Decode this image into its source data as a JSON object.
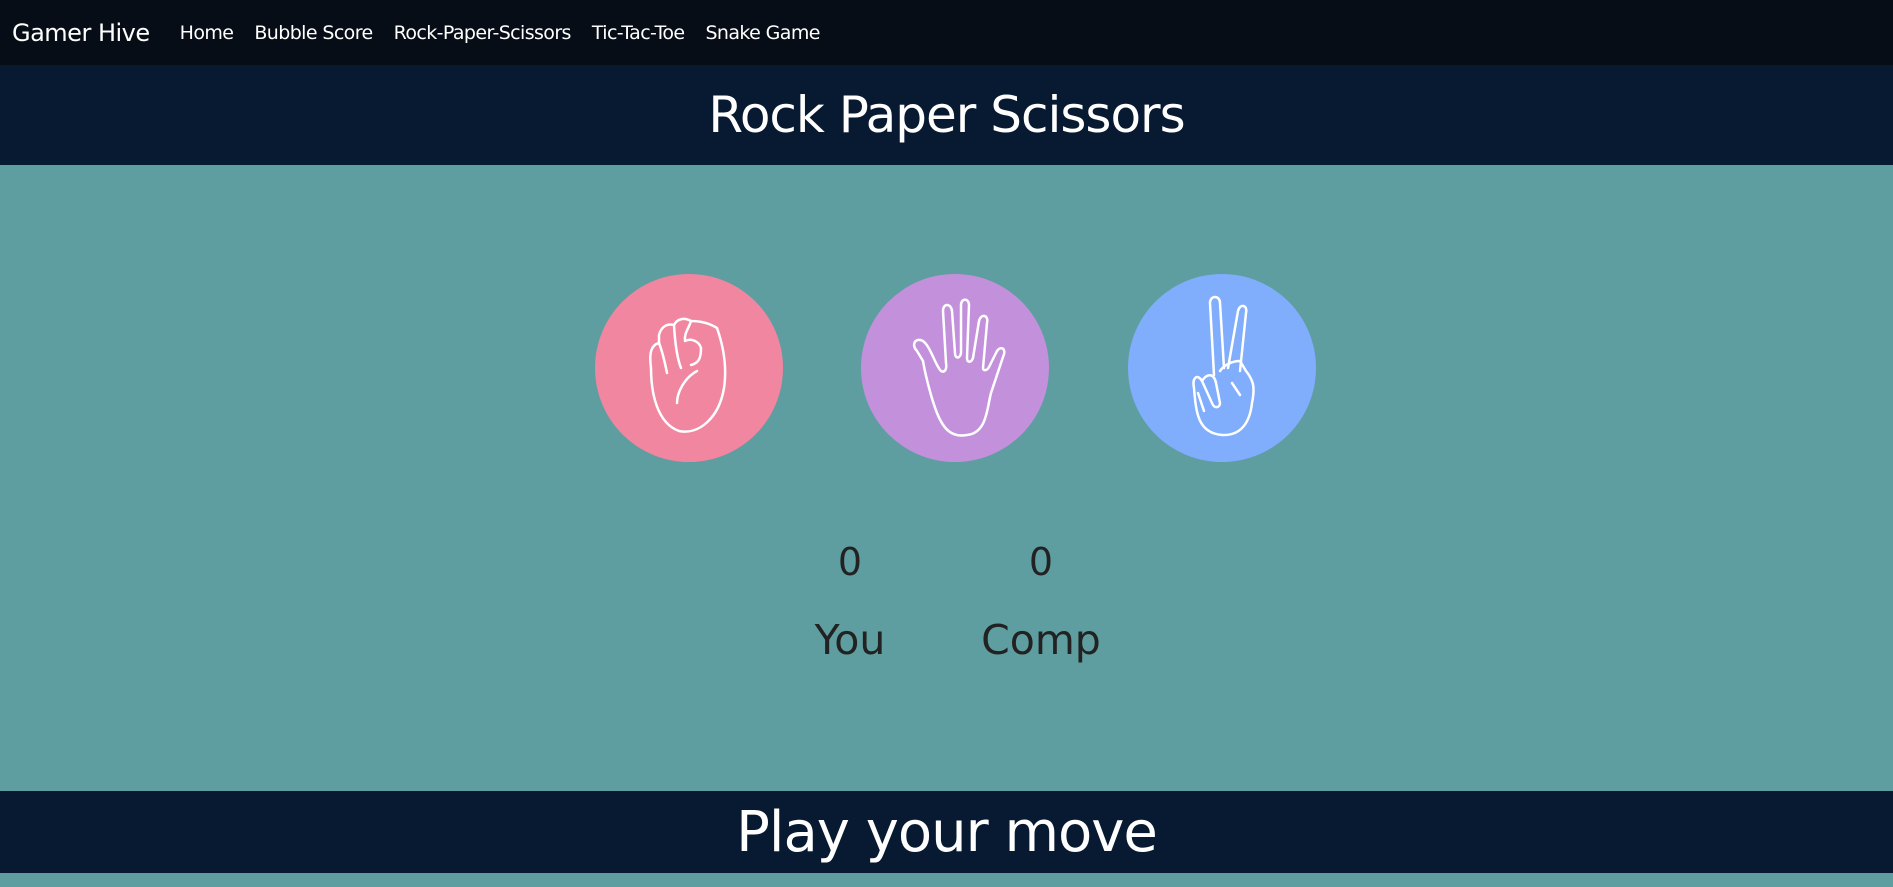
{
  "nav": {
    "brand": "Gamer Hive",
    "links": [
      "Home",
      "Bubble Score",
      "Rock-Paper-Scissors",
      "Tic-Tac-Toe",
      "Snake Game"
    ]
  },
  "header": {
    "title": "Rock Paper Scissors"
  },
  "choices": [
    {
      "name": "rock",
      "icon": "fist-icon",
      "color": "#f086a0"
    },
    {
      "name": "paper",
      "icon": "open-hand-icon",
      "color": "#c390dc"
    },
    {
      "name": "scissors",
      "icon": "peace-hand-icon",
      "color": "#80adfc"
    }
  ],
  "scoreboard": {
    "user_score": "0",
    "user_label": "You",
    "comp_score": "0",
    "comp_label": "Comp"
  },
  "message": "Play your move"
}
